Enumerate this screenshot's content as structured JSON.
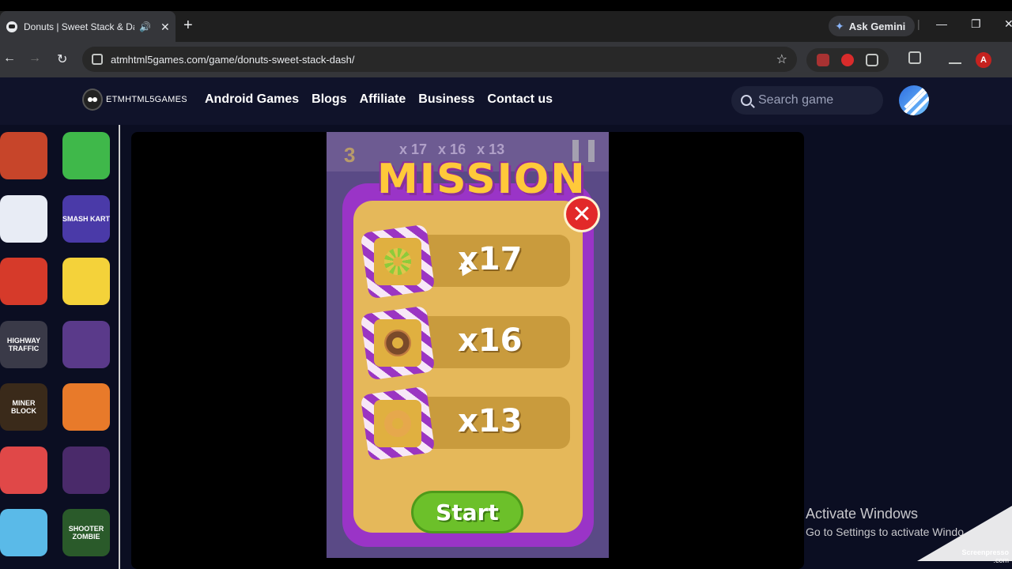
{
  "browser": {
    "tab_title": "Donuts | Sweet Stack & Dash",
    "gemini_label": "Ask Gemini",
    "url": "atmhtml5games.com/game/donuts-sweet-stack-dash/",
    "profile_initial": "A"
  },
  "site": {
    "logo_text": "ETMHTML5GAMES",
    "nav": [
      "Android Games",
      "Blogs",
      "Affiliate",
      "Business",
      "Contact us"
    ],
    "search_placeholder": "Search game"
  },
  "sidebar": {
    "thumbnails": [
      {
        "name": "subway-runner",
        "label": "",
        "color": "#c7452a"
      },
      {
        "name": "tower-stack",
        "label": "",
        "color": "#3fb84a"
      },
      {
        "name": "ninja",
        "label": "",
        "color": "#e8ecf5"
      },
      {
        "name": "smash-kart",
        "label": "SMASH KART",
        "color": "#4a3aa8"
      },
      {
        "name": "cards",
        "label": "",
        "color": "#d63a2a"
      },
      {
        "name": "baby-face",
        "label": "",
        "color": "#f4d23a"
      },
      {
        "name": "highway-traffic",
        "label": "HIGHWAY TRAFFIC",
        "color": "#3a3a48"
      },
      {
        "name": "sword-battle",
        "label": "",
        "color": "#5a3a8a"
      },
      {
        "name": "miner-block",
        "label": "MINER BLOCK",
        "color": "#3a2a1a"
      },
      {
        "name": "monsters",
        "label": "",
        "color": "#e87a2a"
      },
      {
        "name": "chicken",
        "label": "",
        "color": "#e04848"
      },
      {
        "name": "slot-machine",
        "label": "",
        "color": "#4a2a6a"
      },
      {
        "name": "girl-character",
        "label": "",
        "color": "#5abae8"
      },
      {
        "name": "shooter-zombie",
        "label": "SHOOTER ZOMBIE",
        "color": "#2a5a2a"
      }
    ]
  },
  "game": {
    "level": "3",
    "hud_counts": [
      "x 17",
      "x 16",
      "x 13"
    ],
    "title": "MISSION",
    "missions": [
      {
        "donut": "green-donut",
        "count": "x17"
      },
      {
        "donut": "chocolate-donut",
        "count": "x16"
      },
      {
        "donut": "plain-donut",
        "count": "x13"
      }
    ],
    "start_label": "Start"
  },
  "overlay": {
    "activate_title": "Activate Windows",
    "activate_sub": "Go to Settings to activate Windo",
    "watermark": "Screenpresso",
    "watermark_sub": ".com"
  }
}
